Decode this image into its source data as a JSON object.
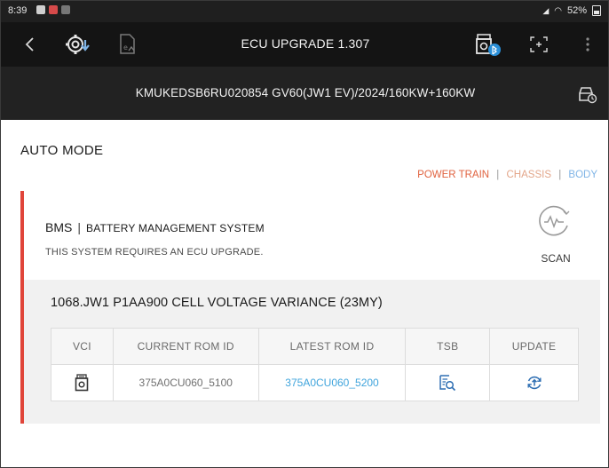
{
  "status_bar": {
    "time": "8:39",
    "battery": "52%",
    "notifications": [
      "gallery-icon",
      "n-icon",
      "data-icon"
    ]
  },
  "app_bar": {
    "title": "ECU UPGRADE 1.307",
    "icons": [
      "back-icon",
      "ecu-download-icon",
      "file-icon",
      "vci-bluetooth-icon",
      "expand-icon",
      "more-icon"
    ]
  },
  "vehicle": {
    "info": "KMUKEDSB6RU020854  GV60(JW1 EV)/2024/160KW+160KW"
  },
  "mode": {
    "title": "AUTO MODE"
  },
  "filters": {
    "power_train": "POWER TRAIN",
    "chassis": "CHASSIS",
    "body": "BODY",
    "separator": "|"
  },
  "system": {
    "code": "BMS",
    "separator": "|",
    "name": "BATTERY MANAGEMENT SYSTEM",
    "message": "THIS SYSTEM REQUIRES AN ECU UPGRADE.",
    "scan_label": "SCAN",
    "accent_color": "#e0453a"
  },
  "dtc": {
    "title": "1068.JW1 P1AA900 CELL VOLTAGE VARIANCE (23MY)"
  },
  "table": {
    "headers": [
      "VCI",
      "CURRENT ROM ID",
      "LATEST ROM ID",
      "TSB",
      "UPDATE"
    ],
    "rows": [
      {
        "vci_icon": "vci-icon",
        "current_rom": "375A0CU060_5100",
        "latest_rom": "375A0CU060_5200",
        "tsb_icon": "tsb-search-icon",
        "update_icon": "update-icon"
      }
    ]
  }
}
